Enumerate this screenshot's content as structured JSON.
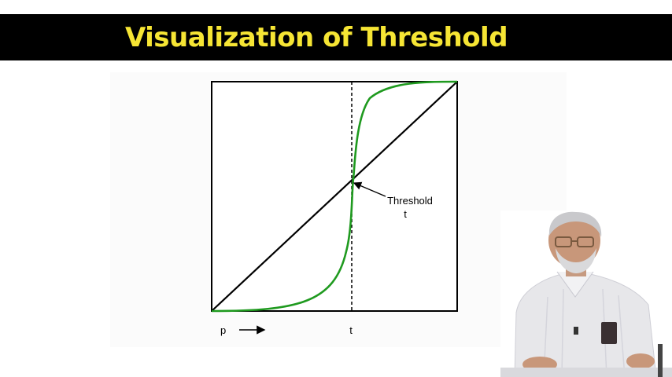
{
  "slide": {
    "title": "Visualization of Threshold"
  },
  "diagram": {
    "threshold_label_line1": "Threshold",
    "threshold_label_line2": "t",
    "x_axis_label": "p",
    "x_axis_t_label": "t"
  },
  "colors": {
    "title_bar": "#000000",
    "title_text": "#f6e534",
    "s_curve": "#1f9a1f",
    "diagonal": "#000000"
  }
}
